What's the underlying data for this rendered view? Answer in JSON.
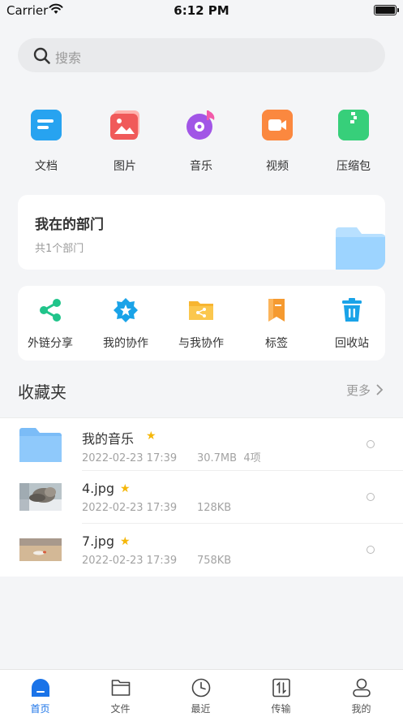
{
  "status_bar": {
    "carrier": "Carrier",
    "time": "6:12 PM"
  },
  "search": {
    "placeholder": "搜索"
  },
  "categories": [
    {
      "label": "文档",
      "icon": "document-icon"
    },
    {
      "label": "图片",
      "icon": "image-icon"
    },
    {
      "label": "音乐",
      "icon": "music-icon"
    },
    {
      "label": "视频",
      "icon": "video-icon"
    },
    {
      "label": "压缩包",
      "icon": "archive-icon"
    }
  ],
  "department": {
    "title": "我在的部门",
    "subtitle": "共1个部门"
  },
  "tools": [
    {
      "label": "外链分享",
      "icon": "share-link-icon"
    },
    {
      "label": "我的协作",
      "icon": "my-collaboration-icon"
    },
    {
      "label": "与我协作",
      "icon": "shared-with-me-icon"
    },
    {
      "label": "标签",
      "icon": "bookmark-icon"
    },
    {
      "label": "回收站",
      "icon": "trash-icon"
    }
  ],
  "favorites": {
    "title": "收藏夹",
    "more": "更多",
    "items": [
      {
        "name": "我的音乐",
        "date": "2022-02-23 17:39",
        "size": "30.7MB",
        "count": "4项",
        "type": "folder"
      },
      {
        "name": "4.jpg",
        "date": "2022-02-23 17:39",
        "size": "128KB",
        "type": "image"
      },
      {
        "name": "7.jpg",
        "date": "2022-02-23 17:39",
        "size": "758KB",
        "type": "image"
      }
    ]
  },
  "tabs": [
    {
      "label": "首页",
      "icon": "home-icon",
      "active": true
    },
    {
      "label": "文件",
      "icon": "folder-icon",
      "active": false
    },
    {
      "label": "最近",
      "icon": "clock-icon",
      "active": false
    },
    {
      "label": "传输",
      "icon": "transfer-icon",
      "active": false
    },
    {
      "label": "我的",
      "icon": "profile-icon",
      "active": false
    }
  ],
  "colors": {
    "accent": "#1a73e8",
    "star": "#f5b70a",
    "tool_green": "#20c48a",
    "tool_blue": "#1aa3e8",
    "tool_orange": "#f59a30"
  }
}
